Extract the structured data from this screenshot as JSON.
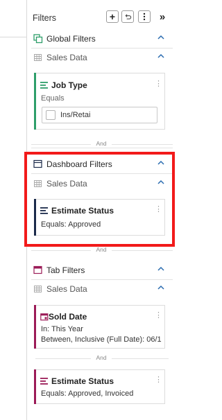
{
  "panel": {
    "title": "Filters",
    "collapse_glyph": "»"
  },
  "icons": {
    "add": "plus-icon",
    "undo": "undo-icon",
    "more": "more-vertical-icon",
    "collapse": "double-chevron-right-icon"
  },
  "global_filters": {
    "label": "Global Filters",
    "source": "Sales Data",
    "card": {
      "title": "Job Type",
      "operator": "Equals",
      "option": "Ins/Retai",
      "checked": false
    }
  },
  "and_label": "And",
  "dashboard_filters": {
    "label": "Dashboard Filters",
    "source": "Sales Data",
    "card": {
      "title": "Estimate Status",
      "value": "Equals: Approved"
    }
  },
  "tab_filters": {
    "label": "Tab Filters",
    "source": "Sales Data",
    "cards": [
      {
        "title": "Sold Date",
        "line1": "In: This Year",
        "line2": "Between, Inclusive (Full Date): 06/1"
      },
      {
        "title": "Estimate Status",
        "line1": "Equals: Approved, Invoiced"
      }
    ]
  },
  "colors": {
    "global_accent": "#2e9e6a",
    "dashboard_accent": "#1b2a4a",
    "tab_accent": "#9b1b57",
    "chevron": "#2b6cb0",
    "highlight": "#f21a1a"
  }
}
